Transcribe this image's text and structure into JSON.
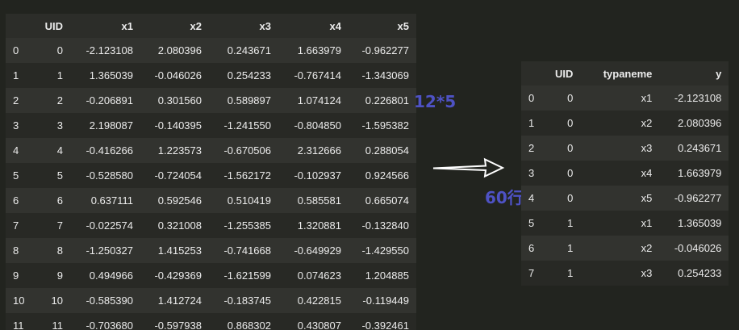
{
  "left_table": {
    "columns": [
      "",
      "UID",
      "x1",
      "x2",
      "x3",
      "x4",
      "x5"
    ],
    "rows": [
      [
        "0",
        "0",
        "-2.123108",
        "2.080396",
        "0.243671",
        "1.663979",
        "-0.962277"
      ],
      [
        "1",
        "1",
        "1.365039",
        "-0.046026",
        "0.254233",
        "-0.767414",
        "-1.343069"
      ],
      [
        "2",
        "2",
        "-0.206891",
        "0.301560",
        "0.589897",
        "1.074124",
        "0.226801"
      ],
      [
        "3",
        "3",
        "2.198087",
        "-0.140395",
        "-1.241550",
        "-0.804850",
        "-1.595382"
      ],
      [
        "4",
        "4",
        "-0.416266",
        "1.223573",
        "-0.670506",
        "2.312666",
        "0.288054"
      ],
      [
        "5",
        "5",
        "-0.528580",
        "-0.724054",
        "-1.562172",
        "-0.102937",
        "0.924566"
      ],
      [
        "6",
        "6",
        "0.637111",
        "0.592546",
        "0.510419",
        "0.585581",
        "0.665074"
      ],
      [
        "7",
        "7",
        "-0.022574",
        "0.321008",
        "-1.255385",
        "1.320881",
        "-0.132840"
      ],
      [
        "8",
        "8",
        "-1.250327",
        "1.415253",
        "-0.741668",
        "-0.649929",
        "-1.429550"
      ],
      [
        "9",
        "9",
        "0.494966",
        "-0.429369",
        "-1.621599",
        "0.074623",
        "1.204885"
      ],
      [
        "10",
        "10",
        "-0.585390",
        "1.412724",
        "-0.183745",
        "0.422815",
        "-0.119449"
      ],
      [
        "11",
        "11",
        "-0.703680",
        "-0.597938",
        "0.868302",
        "0.430807",
        "-0.392461"
      ]
    ]
  },
  "right_table": {
    "columns": [
      "",
      "UID",
      "typaneme",
      "y"
    ],
    "rows": [
      [
        "0",
        "0",
        "x1",
        "-2.123108"
      ],
      [
        "1",
        "0",
        "x2",
        "2.080396"
      ],
      [
        "2",
        "0",
        "x3",
        "0.243671"
      ],
      [
        "3",
        "0",
        "x4",
        "1.663979"
      ],
      [
        "4",
        "0",
        "x5",
        "-0.962277"
      ],
      [
        "5",
        "1",
        "x1",
        "1.365039"
      ],
      [
        "6",
        "1",
        "x2",
        "-0.046026"
      ],
      [
        "7",
        "1",
        "x3",
        "0.254233"
      ]
    ]
  },
  "annotations": {
    "shape_label": "12*5",
    "rows_label": "60行"
  },
  "colors": {
    "background": "#22241f",
    "annotation": "#4e52c4",
    "arrow": "#ffffff"
  },
  "icons": {
    "arrow": "right-arrow-icon"
  }
}
